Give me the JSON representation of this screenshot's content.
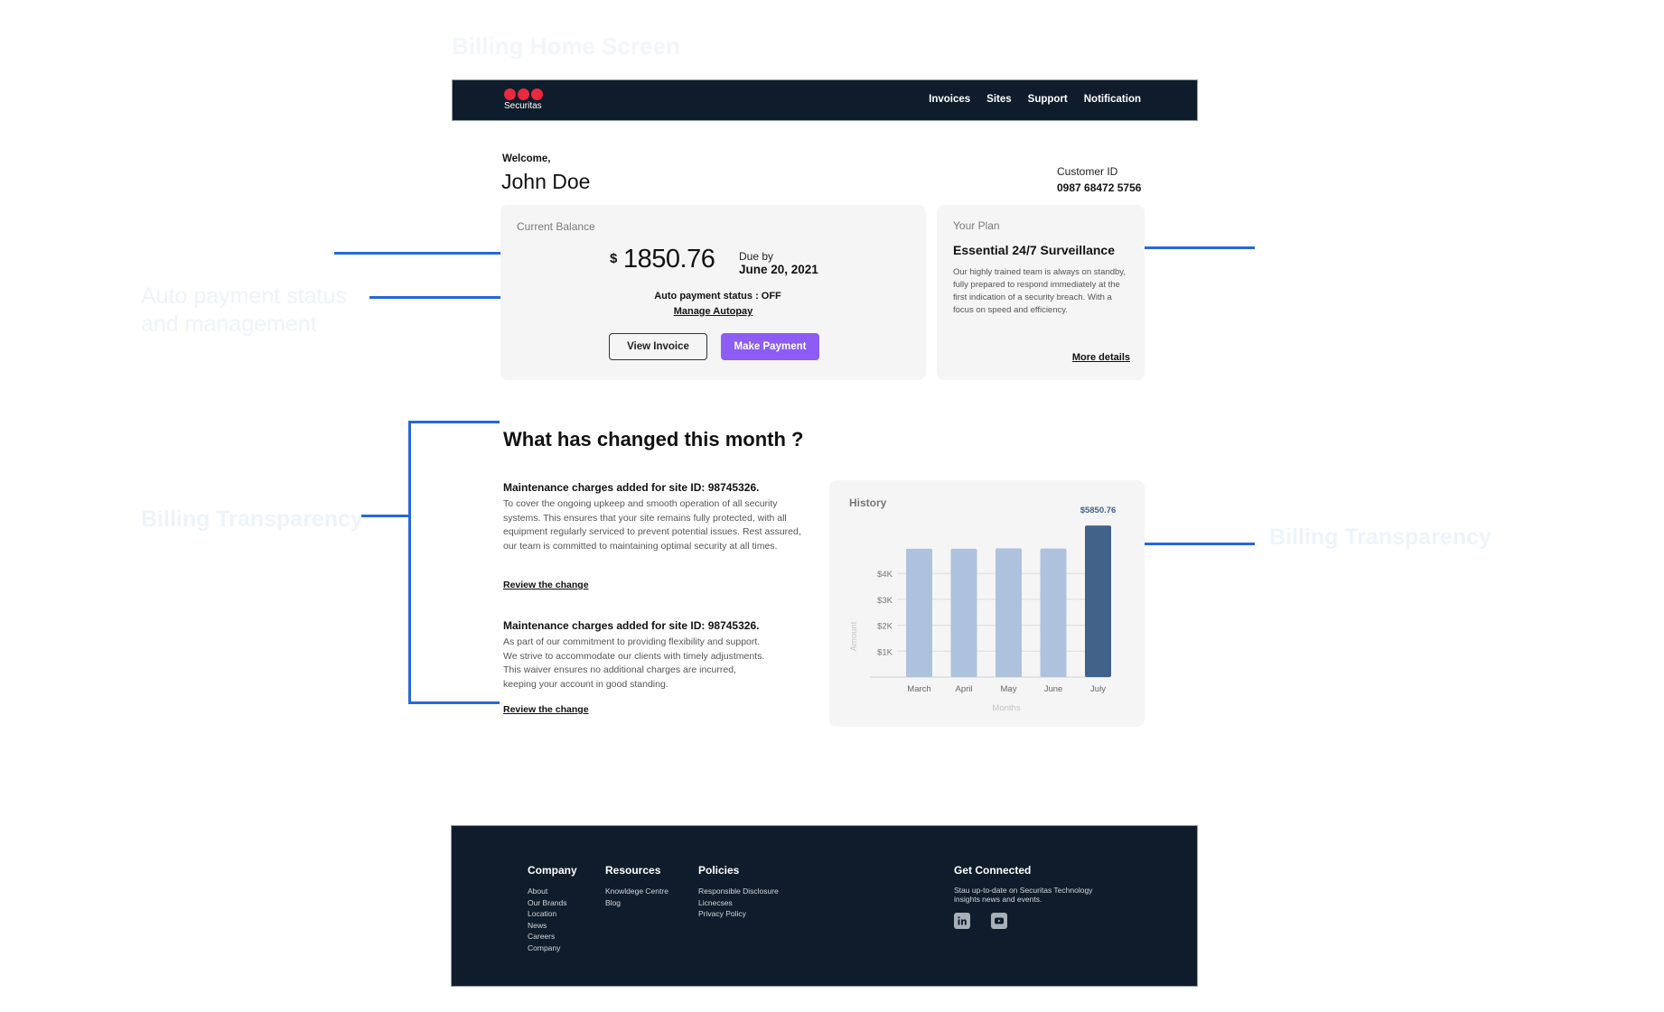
{
  "frame_title": "Billing Home Screen",
  "annotations": {
    "autopay": "Auto payment status and management",
    "transparency_left": "Billing Transparency",
    "transparency_right": "Billing Transparency"
  },
  "header": {
    "logo_text": "Securitas",
    "nav": [
      "Invoices",
      "Sites",
      "Support",
      "Notification"
    ]
  },
  "welcome": {
    "greeting": "Welcome,",
    "name": "John Doe",
    "customer_id_label": "Customer ID",
    "customer_id": "0987 68472 5756"
  },
  "balance": {
    "label": "Current  Balance",
    "currency": "$",
    "amount": "1850.76",
    "due_label": "Due by",
    "due_date": "June 20, 2021",
    "autopay_status": "Auto payment status : OFF",
    "manage_autopay": "Manage Autopay",
    "view_invoice": "View  Invoice",
    "make_payment": "Make Payment"
  },
  "plan": {
    "label": "Your Plan",
    "name": "Essential 24/7 Surveillance",
    "description": "Our highly trained team is always on standby, fully prepared to respond immediately at the first indication of a security breach. With a focus on speed and efficiency.",
    "more_details": "More  details"
  },
  "changes": {
    "title": "What has changed this month ?",
    "items": [
      {
        "title": "Maintenance charges added for site ID: 98745326.",
        "description": "To cover the ongoing upkeep and smooth operation of all security systems. This ensures that your site remains fully protected, with all equipment regularly serviced to prevent potential issues. Rest assured, our team is committed to maintaining optimal security at all times.",
        "link": "Review the change"
      },
      {
        "title": "Maintenance charges added for site ID: 98745326.",
        "description": "As part of our commitment to providing flexibility and support. We strive to accommodate our clients with timely adjustments. This waiver ensures no additional charges are incurred, keeping your account in good standing.",
        "link": "Review the change"
      }
    ]
  },
  "history": {
    "title": "History"
  },
  "chart_data": {
    "type": "bar",
    "title": "History",
    "categories": [
      "March",
      "April",
      "May",
      "June",
      "July"
    ],
    "values": [
      4950,
      4950,
      4970,
      4960,
      5850.76
    ],
    "highlight_index": 4,
    "highlight_label": "$5850.76",
    "xlabel": "Months",
    "ylabel": "Amount",
    "yticks": [
      1000,
      2000,
      3000,
      4000
    ],
    "ytick_labels": [
      "$1K",
      "$2K",
      "$3K",
      "$4K"
    ],
    "ylim": [
      0,
      5850.76
    ],
    "grid": true,
    "colors": {
      "normal": "#aec2dd",
      "highlight": "#42628a"
    }
  },
  "footer": {
    "columns": [
      {
        "heading": "Company",
        "links": [
          "About",
          "Our Brands",
          "Location",
          "News",
          "Careers",
          "Company"
        ]
      },
      {
        "heading": "Resources",
        "links": [
          "Knowldege Centre",
          "Blog"
        ]
      },
      {
        "heading": "Policies",
        "links": [
          "Responsible Disclosure",
          "Licnecses",
          "Privacy Policy"
        ]
      }
    ],
    "get_connected": {
      "heading": "Get Connected",
      "text": "Stau up-to-date on Securitas Technology insights news and events.",
      "social": [
        "linkedin-icon",
        "youtube-icon"
      ]
    }
  },
  "colors": {
    "brand_dark": "#0f1c2b",
    "brand_red": "#e8293f",
    "primary_button": "#8c5cf5",
    "annotation_blue": "#2668d9"
  }
}
